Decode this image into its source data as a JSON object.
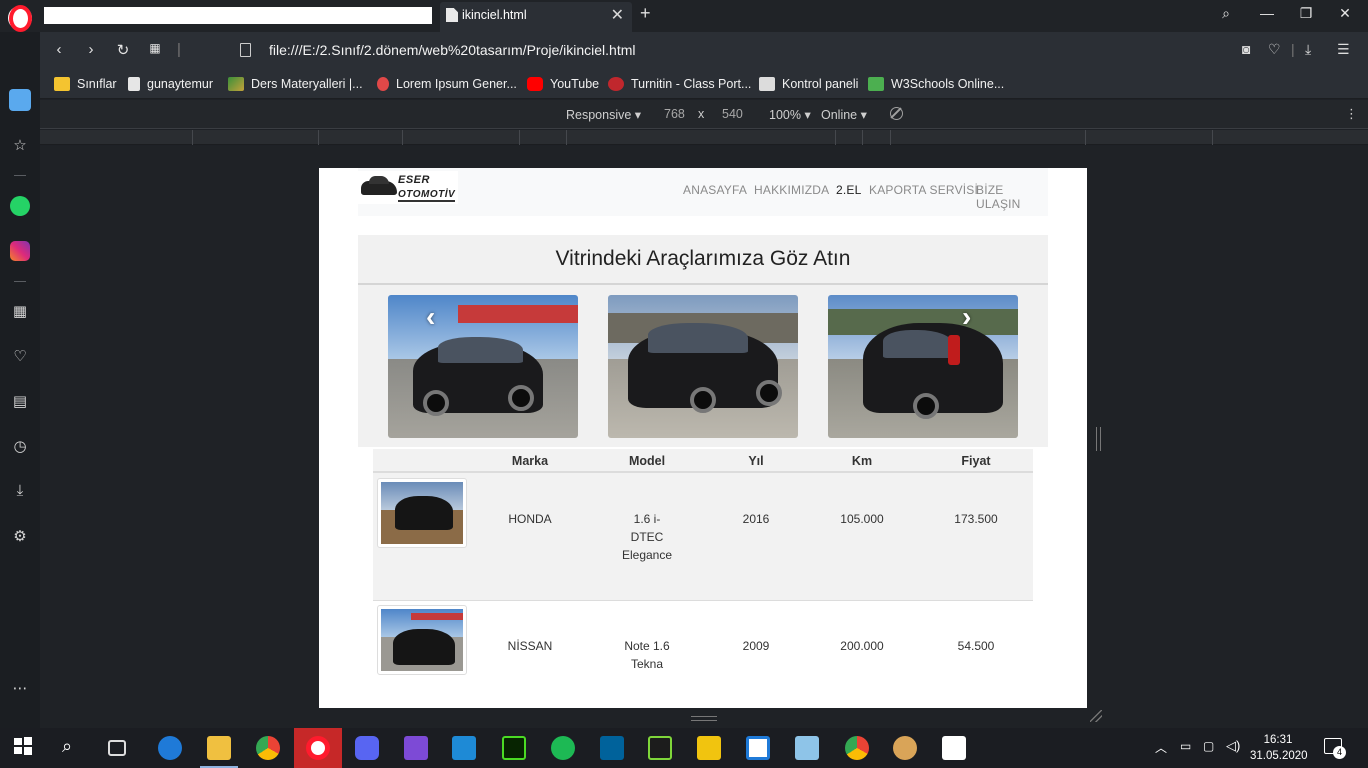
{
  "browser": {
    "active_tab_title": "ikinciel.html",
    "url": "file:///E:/2.Sınıf/2.dönem/web%20tasarım/Proje/ikinciel.html",
    "bookmarks": [
      "Sınıflar",
      "gunaytemur",
      "Ders Materyalleri |...",
      "Lorem Ipsum Gener...",
      "YouTube",
      "Turnitin - Class Port...",
      "Kontrol paneli",
      "W3Schools Online..."
    ],
    "device_toolbar": {
      "mode": "Responsive",
      "width": "768",
      "times": "x",
      "height": "540",
      "zoom": "100%",
      "network": "Online"
    }
  },
  "site": {
    "logo": {
      "line1": "ESER",
      "line2": "OTOMOTİV"
    },
    "nav": [
      "ANASAYFA",
      "HAKKIMIZDA",
      "2.EL",
      "KAPORTA SERVİSİ",
      "BİZE ULAŞIN"
    ],
    "heading": "Vitrindeki Araçlarımıza Göz Atın",
    "carousel_prev": "‹",
    "carousel_next": "›",
    "table": {
      "headers": [
        "Marka",
        "Model",
        "Yıl",
        "Km",
        "Fiyat"
      ],
      "rows": [
        {
          "marka": "HONDA",
          "model_l1": "1.6 i-",
          "model_l2": "DTEC",
          "model_l3": "Elegance",
          "yil": "2016",
          "km": "105.000",
          "fiyat": "173.500"
        },
        {
          "marka": "NİSSAN",
          "model_l1": "Note 1.6",
          "model_l2": "Tekna",
          "model_l3": "",
          "yil": "2009",
          "km": "200.000",
          "fiyat": "54.500"
        }
      ]
    }
  },
  "taskbar": {
    "time": "16:31",
    "date": "31.05.2020",
    "notifications": "4"
  },
  "colors": {
    "opera_red": "#ff1b2d",
    "chrome_dark": "#2b2f35",
    "page_bg": "#ffffff",
    "nav_bg": "#f8f9fa"
  }
}
